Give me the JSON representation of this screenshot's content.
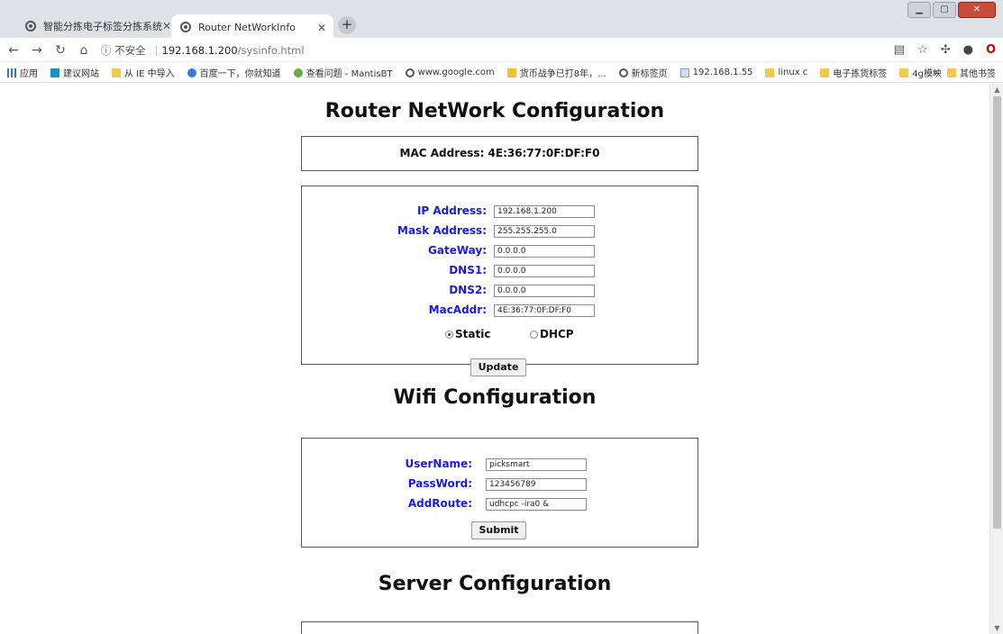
{
  "browser": {
    "tabs": [
      {
        "title": "智能分拣电子标签分拣系统",
        "active": false
      },
      {
        "title": "Router NetWorkInfo",
        "active": true
      }
    ],
    "new_tab_label": "+",
    "insecure_label": "ⓘ 不安全",
    "url_host": "192.168.1.200",
    "url_path": "/sysinfo.html",
    "bookmarks": [
      "应用",
      "建议网站",
      "从 IE 中导入",
      "百度一下，你就知道",
      "查看问题 - MantisBT",
      "www.google.com",
      "货币战争已打8年，...",
      "新标签页",
      "192.168.1.55",
      "linux c",
      "电子拣货标签",
      "4g模块"
    ],
    "bookmarks_more": "»",
    "bookmarks_other": "其他书签"
  },
  "page": {
    "router_title": "Router NetWork Configuration",
    "mac_line": "MAC Address: 4E:36:77:0F:DF:F0",
    "network": {
      "fields": [
        {
          "label": "IP Address:",
          "value": "192.168.1.200"
        },
        {
          "label": "Mask Address:",
          "value": "255.255.255.0"
        },
        {
          "label": "GateWay:",
          "value": "0.0.0.0"
        },
        {
          "label": "DNS1:",
          "value": "0.0.0.0"
        },
        {
          "label": "DNS2:",
          "value": "0.0.0.0"
        },
        {
          "label": "MacAddr:",
          "value": "4E:36:77:0F:DF:F0"
        }
      ],
      "mode_static": "Static",
      "mode_dhcp": "DHCP",
      "selected_mode": "Static",
      "update_label": "Update"
    },
    "wifi_title": "Wifi Configuration",
    "wifi": {
      "fields": [
        {
          "label": "UserName:",
          "value": "picksmart"
        },
        {
          "label": "PassWord:",
          "value": "123456789"
        },
        {
          "label": "AddRoute:",
          "value": "udhcpc -ira0 &"
        }
      ],
      "submit_label": "Submit"
    },
    "server_title": "Server Configuration"
  },
  "colors": {
    "label_blue": "#1a1ae6",
    "chrome_frame": "#dee1e6"
  }
}
